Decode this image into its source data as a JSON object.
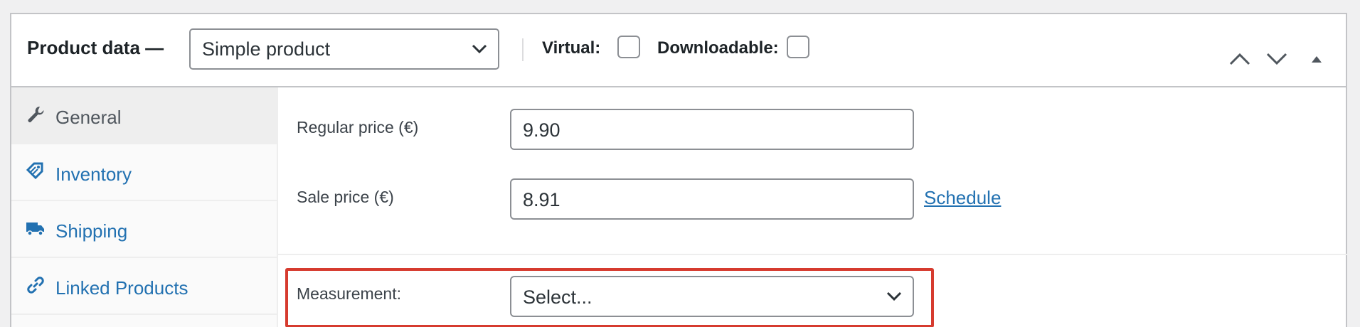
{
  "header": {
    "title": "Product data —",
    "product_type": {
      "selected": "Simple product",
      "icon": "chevron-down-icon"
    },
    "virtual_label": "Virtual:",
    "virtual_checked": false,
    "downloadable_label": "Downloadable:",
    "downloadable_checked": false,
    "controls": [
      "move-up-icon",
      "move-down-icon",
      "collapse-icon"
    ]
  },
  "sidebar": {
    "tabs": [
      {
        "label": "General",
        "icon": "wrench-icon",
        "active": true
      },
      {
        "label": "Inventory",
        "icon": "tag-icon",
        "active": false
      },
      {
        "label": "Shipping",
        "icon": "truck-icon",
        "active": false
      },
      {
        "label": "Linked Products",
        "icon": "link-icon",
        "active": false
      }
    ]
  },
  "general": {
    "regular_price": {
      "label": "Regular price (€)",
      "value": "9.90"
    },
    "sale_price": {
      "label": "Sale price (€)",
      "value": "8.91",
      "schedule_link": "Schedule"
    },
    "measurement": {
      "label": "Measurement:",
      "selected": "Select..."
    }
  },
  "colors": {
    "accent": "#2271b1",
    "highlight": "#d63b2f",
    "border": "#8c8f94"
  }
}
